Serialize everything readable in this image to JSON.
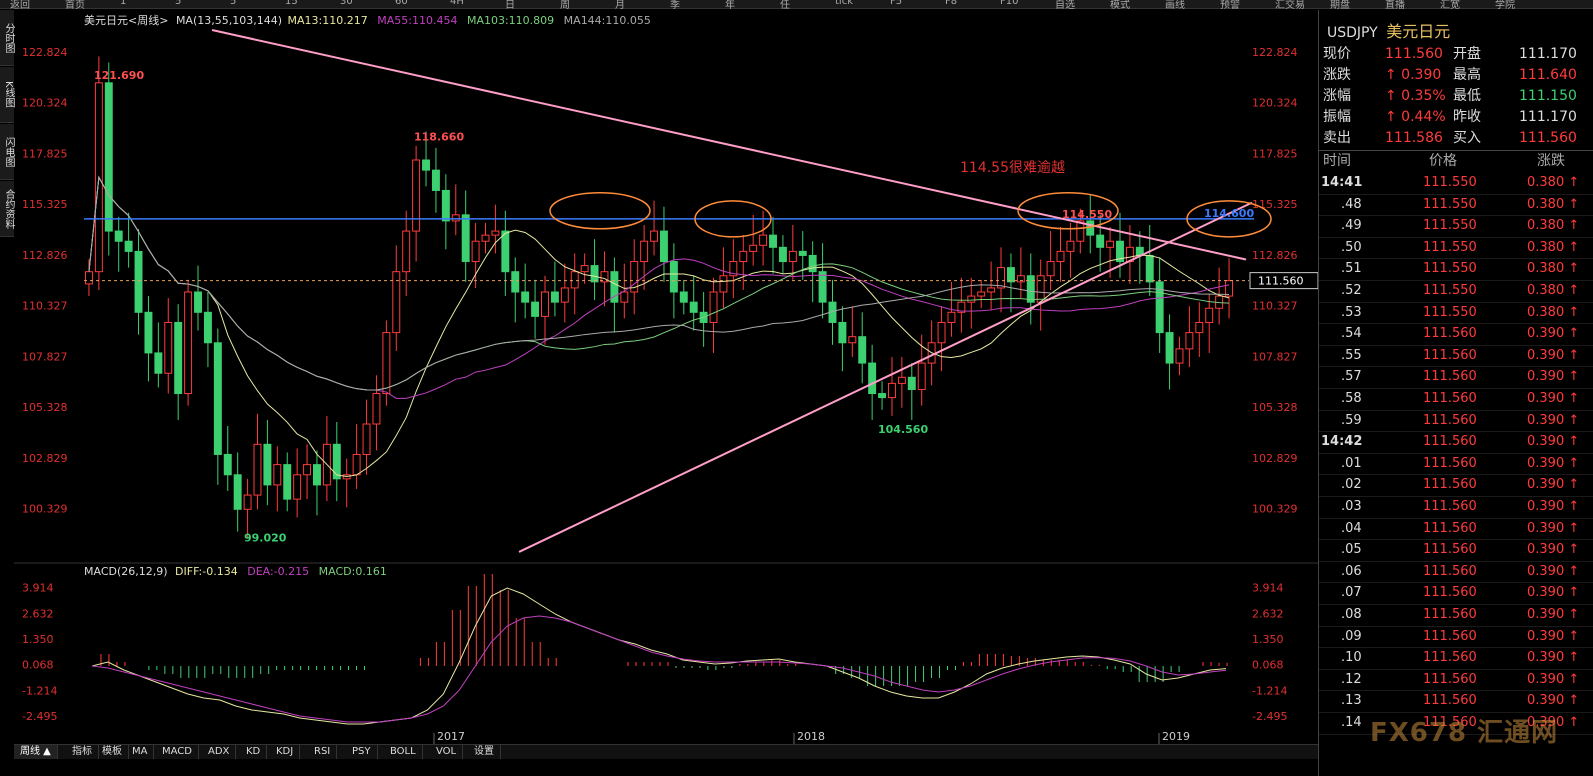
{
  "topbar": [
    "返回",
    "首页",
    "1",
    "5",
    "5",
    "15",
    "30",
    "60",
    "4H",
    "日",
    "周",
    "月",
    "季",
    "年",
    "任",
    "tick",
    "F5",
    "F8",
    "F10",
    "自选",
    "模式",
    "画线",
    "预警",
    "汇交易",
    "期盘",
    "直播",
    "汇宽",
    "学院"
  ],
  "left_tabs": [
    "分时图",
    "K线图",
    "闪电图",
    "合约资料"
  ],
  "legend_main": {
    "symbol": "美元日元",
    "period": "周线",
    "ma": "MA(13,55,103,144)",
    "ma13": "MA13:110.217",
    "ma55": "MA55:110.454",
    "ma103": "MA103:110.809",
    "ma144": "MA144:110.055"
  },
  "legend_macd": {
    "label": "MACD(26,12,9)",
    "diff": "DIFF:-0.134",
    "dea": "DEA:-0.215",
    "macd": "MACD:0.161"
  },
  "price_axis": [
    "122.824",
    "120.324",
    "117.825",
    "115.325",
    "112.826",
    "110.327",
    "107.827",
    "105.328",
    "102.829",
    "100.329"
  ],
  "macd_axis": [
    "3.914",
    "2.632",
    "1.350",
    "0.068",
    "-1.214",
    "-2.495"
  ],
  "time_axis": [
    "2017",
    "2018",
    "2019"
  ],
  "annotations": {
    "high1": "121.690",
    "low1": "99.020",
    "high2": "118.660",
    "low2": "104.560",
    "level_text": "114.55很难逾越",
    "level1": "114.550",
    "level2": "114.600",
    "last_price": "111.560"
  },
  "bottom_tabs": [
    "周线 ▲",
    "指标",
    "模板",
    "MA",
    "MACD",
    "ADX",
    "KD",
    "KDJ",
    "RSI",
    "PSY",
    "BOLL",
    "VOL",
    "设置"
  ],
  "quote": {
    "symbol": "USDJPY",
    "name": "美元日元",
    "rows": [
      {
        "l1": "现价",
        "v1": "111.560",
        "c1": "red",
        "l2": "开盘",
        "v2": "111.170",
        "c2": "white"
      },
      {
        "l1": "涨跌",
        "v1": "↑ 0.390",
        "c1": "red",
        "l2": "最高",
        "v2": "111.640",
        "c2": "red"
      },
      {
        "l1": "涨幅",
        "v1": "↑ 0.35%",
        "c1": "red",
        "l2": "最低",
        "v2": "111.150",
        "c2": "green"
      },
      {
        "l1": "振幅",
        "v1": "↑ 0.44%",
        "c1": "red",
        "l2": "昨收",
        "v2": "111.170",
        "c2": "white"
      },
      {
        "l1": "卖出",
        "v1": "111.586",
        "c1": "red",
        "l2": "买入",
        "v2": "111.560",
        "c2": "red"
      }
    ]
  },
  "ticks_header": [
    "时间",
    "价格",
    "涨跌"
  ],
  "ticks": [
    {
      "t": "14:41",
      "p": "111.550",
      "c": "0.380 ↑"
    },
    {
      "t": ".48",
      "p": "111.550",
      "c": "0.380 ↑"
    },
    {
      "t": ".49",
      "p": "111.550",
      "c": "0.380 ↑"
    },
    {
      "t": ".50",
      "p": "111.550",
      "c": "0.380 ↑"
    },
    {
      "t": ".51",
      "p": "111.550",
      "c": "0.380 ↑"
    },
    {
      "t": ".52",
      "p": "111.550",
      "c": "0.380 ↑"
    },
    {
      "t": ".53",
      "p": "111.550",
      "c": "0.380 ↑"
    },
    {
      "t": ".54",
      "p": "111.560",
      "c": "0.390 ↑"
    },
    {
      "t": ".55",
      "p": "111.560",
      "c": "0.390 ↑"
    },
    {
      "t": ".57",
      "p": "111.560",
      "c": "0.390 ↑"
    },
    {
      "t": ".58",
      "p": "111.560",
      "c": "0.390 ↑"
    },
    {
      "t": ".59",
      "p": "111.560",
      "c": "0.390 ↑"
    },
    {
      "t": "14:42",
      "p": "111.560",
      "c": "0.390 ↑"
    },
    {
      "t": ".01",
      "p": "111.560",
      "c": "0.390 ↑"
    },
    {
      "t": ".02",
      "p": "111.560",
      "c": "0.390 ↑"
    },
    {
      "t": ".03",
      "p": "111.560",
      "c": "0.390 ↑"
    },
    {
      "t": ".04",
      "p": "111.560",
      "c": "0.390 ↑"
    },
    {
      "t": ".05",
      "p": "111.560",
      "c": "0.390 ↑"
    },
    {
      "t": ".06",
      "p": "111.560",
      "c": "0.390 ↑"
    },
    {
      "t": ".07",
      "p": "111.560",
      "c": "0.390 ↑"
    },
    {
      "t": ".08",
      "p": "111.560",
      "c": "0.390 ↑"
    },
    {
      "t": ".09",
      "p": "111.560",
      "c": "0.390 ↑"
    },
    {
      "t": ".10",
      "p": "111.560",
      "c": "0.390 ↑"
    },
    {
      "t": ".12",
      "p": "111.560",
      "c": "0.390 ↑"
    },
    {
      "t": ".13",
      "p": "111.560",
      "c": "0.390 ↑"
    },
    {
      "t": ".14",
      "p": "111.560",
      "c": "0.390 ↑"
    }
  ],
  "watermark": "FX678 汇通网",
  "colors": {
    "up": "#ff3b3b",
    "down": "#3cd070",
    "ma13": "#e8e8a0",
    "ma55": "#c040c0",
    "ma103": "#7ccf7c",
    "ma144": "#aaaaaa",
    "trend": "#ff9ec8",
    "level": "#3a7bff",
    "circle": "#ff8c3a"
  },
  "chart_data": {
    "type": "candlestick",
    "ylim": [
      98.0,
      124.0
    ],
    "macd_ylim": [
      -3.2,
      4.5
    ],
    "weekly_close": [
      112,
      121.3,
      114,
      113.5,
      113,
      110,
      108,
      107,
      109.5,
      106,
      111,
      110,
      108.5,
      103,
      102,
      100.3,
      101,
      103.5,
      101.5,
      102.5,
      100.8,
      102,
      102.5,
      101.5,
      103.5,
      101.8,
      102,
      103,
      104.5,
      106,
      109,
      112,
      114,
      117.5,
      117,
      116,
      114.5,
      114.8,
      112.5,
      113.5,
      113.8,
      114,
      112,
      111,
      110.5,
      109.8,
      111,
      110.5,
      111.2,
      112,
      112.3,
      111.5,
      112,
      110.5,
      111,
      112.5,
      113.5,
      114,
      112.5,
      111,
      110.5,
      110,
      109.5,
      111,
      111.8,
      112.5,
      113,
      113.3,
      113.8,
      113.2,
      112.5,
      113,
      112.8,
      112,
      110.5,
      109.5,
      108.5,
      108.8,
      107.5,
      106,
      105.8,
      106.5,
      106.8,
      106.2,
      107.5,
      108.5,
      109.5,
      110,
      110.5,
      110.8,
      111,
      111.2,
      112.2,
      111.5,
      111.8,
      110.5,
      111.8,
      112.5,
      113,
      113.5,
      114.5,
      113.8,
      113.2,
      113.5,
      112.5,
      113.2,
      112.8,
      111.5,
      109,
      107.5,
      108.2,
      109,
      109.5,
      110.2,
      110.8,
      111.56
    ],
    "diff": [
      0,
      0.2,
      -0.2,
      -0.5,
      -0.8,
      -1.1,
      -1.4,
      -1.6,
      -1.7,
      -2.0,
      -2.2,
      -2.3,
      -2.4,
      -2.6,
      -2.7,
      -2.8,
      -2.9,
      -2.9,
      -2.8,
      -2.7,
      -2.6,
      -2.2,
      -1.4,
      0.2,
      2.0,
      3.5,
      3.9,
      3.6,
      3.1,
      2.6,
      2.2,
      1.9,
      1.6,
      1.3,
      1.1,
      0.8,
      0.6,
      0.3,
      0.2,
      0.1,
      0.15,
      0.25,
      0.3,
      0.35,
      0.2,
      0.1,
      0,
      -0.3,
      -0.6,
      -1.0,
      -1.3,
      -1.5,
      -1.6,
      -1.6,
      -1.3,
      -0.9,
      -0.4,
      -0.1,
      0.1,
      0.25,
      0.35,
      0.45,
      0.5,
      0.45,
      0.3,
      0.1,
      -0.4,
      -0.7,
      -0.6,
      -0.4,
      -0.2,
      -0.134
    ],
    "dea": [
      0,
      -0.1,
      -0.3,
      -0.5,
      -0.7,
      -0.9,
      -1.1,
      -1.3,
      -1.5,
      -1.7,
      -1.9,
      -2.1,
      -2.3,
      -2.5,
      -2.6,
      -2.7,
      -2.8,
      -2.8,
      -2.8,
      -2.7,
      -2.6,
      -2.4,
      -2.0,
      -1.2,
      0,
      1.2,
      2.0,
      2.4,
      2.5,
      2.4,
      2.2,
      1.9,
      1.6,
      1.3,
      1.0,
      0.7,
      0.5,
      0.35,
      0.25,
      0.2,
      0.2,
      0.2,
      0.2,
      0.2,
      0.15,
      0.1,
      0,
      -0.1,
      -0.3,
      -0.5,
      -0.8,
      -1.0,
      -1.2,
      -1.3,
      -1.2,
      -1.0,
      -0.7,
      -0.4,
      -0.15,
      0.05,
      0.2,
      0.3,
      0.4,
      0.42,
      0.38,
      0.25,
      0,
      -0.3,
      -0.45,
      -0.4,
      -0.3,
      -0.215
    ]
  }
}
